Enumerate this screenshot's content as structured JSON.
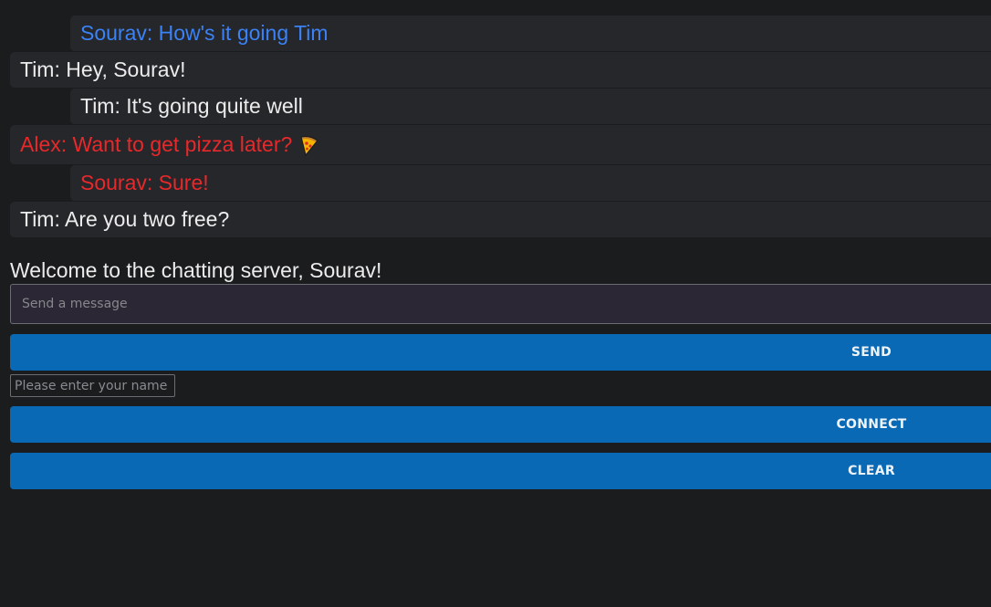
{
  "messages": [
    {
      "text": "Sourav: How's it going Tim",
      "color": "#3b82f6",
      "side": "self"
    },
    {
      "text": "Tim: Hey, Sourav!",
      "color": "#ececec",
      "side": "other"
    },
    {
      "text": "Tim: It's going quite well",
      "color": "#ececec",
      "side": "self"
    },
    {
      "text": "Alex: Want to get pizza later?",
      "color": "#e8282b",
      "side": "other",
      "emoji": "pizza-icon"
    },
    {
      "text": "Sourav: Sure!",
      "color": "#e8282b",
      "side": "self"
    },
    {
      "text": "Tim: Are you two free?",
      "color": "#ececec",
      "side": "other"
    }
  ],
  "welcome_text": "Welcome to the chatting server, Sourav!",
  "message_input": {
    "placeholder": "Send a message",
    "value": ""
  },
  "send_button_label": "SEND",
  "name_input": {
    "placeholder": "Please enter your name",
    "value": ""
  },
  "connect_button_label": "CONNECT",
  "clear_button_label": "CLEAR",
  "colors": {
    "background": "#1b1c1e",
    "message_bg": "#25272a",
    "button_blue": "#0a69b5",
    "self_blue_text": "#3b82f6",
    "red_text": "#e8282b"
  }
}
